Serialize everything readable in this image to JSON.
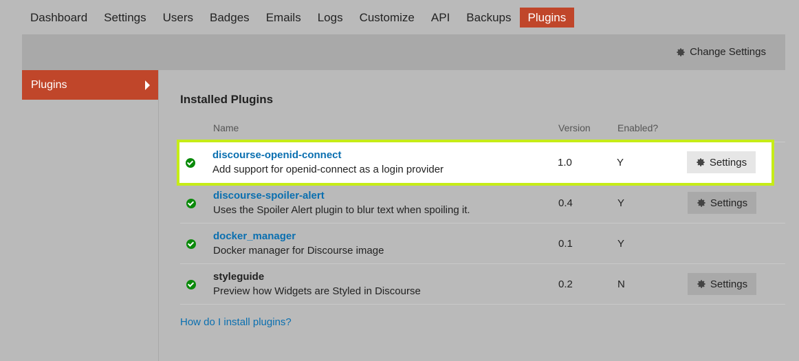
{
  "nav": {
    "items": [
      "Dashboard",
      "Settings",
      "Users",
      "Badges",
      "Emails",
      "Logs",
      "Customize",
      "API",
      "Backups",
      "Plugins"
    ],
    "active": "Plugins"
  },
  "toolbar": {
    "change_settings_label": "Change Settings",
    "icon": "gear-icon"
  },
  "sidebar": {
    "items": [
      {
        "label": "Plugins",
        "active": true
      }
    ]
  },
  "main": {
    "title": "Installed Plugins",
    "columns": {
      "name": "Name",
      "version": "Version",
      "enabled": "Enabled?"
    },
    "plugins": [
      {
        "name": "discourse-openid-connect",
        "description": "Add support for openid-connect as a login provider",
        "version": "1.0",
        "enabled": "Y",
        "settings_label": "Settings",
        "linked": true,
        "highlighted": true
      },
      {
        "name": "discourse-spoiler-alert",
        "description": "Uses the Spoiler Alert plugin to blur text when spoiling it.",
        "version": "0.4",
        "enabled": "Y",
        "settings_label": "Settings",
        "linked": true
      },
      {
        "name": "docker_manager",
        "description": "Docker manager for Discourse image",
        "version": "0.1",
        "enabled": "Y",
        "settings_label": "",
        "linked": true
      },
      {
        "name": "styleguide",
        "description": "Preview how Widgets are Styled in Discourse",
        "version": "0.2",
        "enabled": "N",
        "settings_label": "Settings",
        "linked": false
      }
    ],
    "help_link": "How do I install plugins?"
  },
  "colors": {
    "accent": "#c0462a",
    "link": "#0a6fb0",
    "highlight_outline": "#c6ec17",
    "status_ok": "#0a8a0a"
  }
}
